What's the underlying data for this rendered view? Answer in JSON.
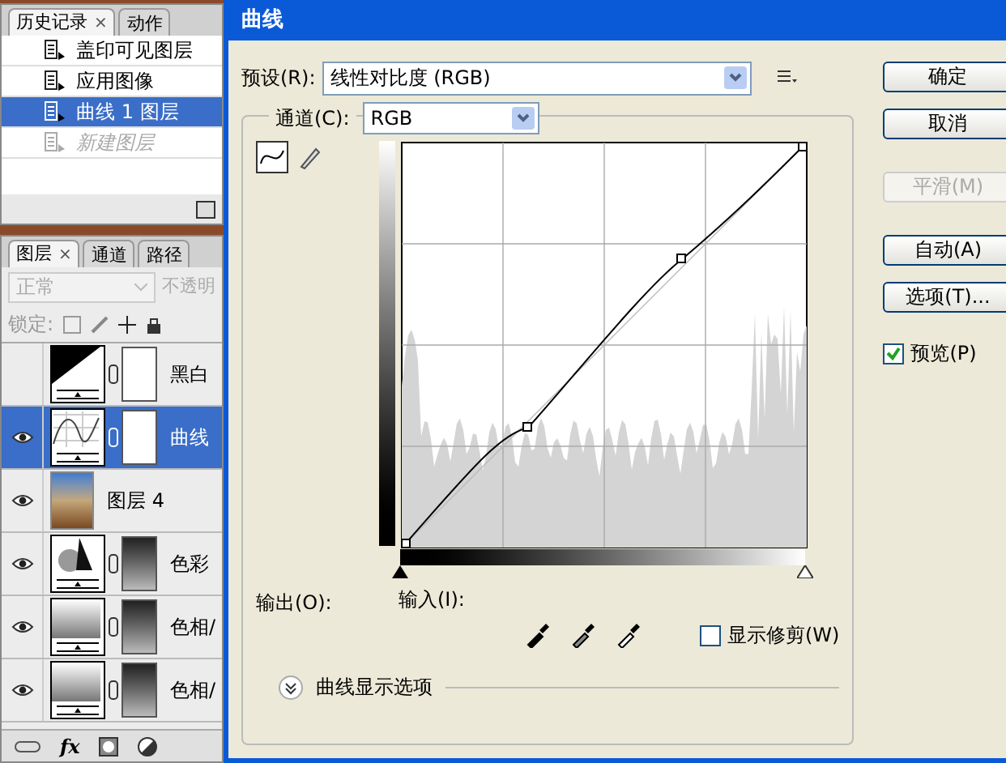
{
  "history": {
    "tabs": [
      {
        "label": "历史记录",
        "close": "×",
        "selected": true
      },
      {
        "label": "动作",
        "selected": false
      }
    ],
    "items": [
      {
        "label": "盖印可见图层",
        "selected": false,
        "disabled": false
      },
      {
        "label": "应用图像",
        "selected": false,
        "disabled": false
      },
      {
        "label": "曲线 1 图层",
        "selected": true,
        "disabled": false
      },
      {
        "label": "新建图层",
        "selected": false,
        "disabled": true
      }
    ]
  },
  "layers": {
    "tabs": [
      {
        "label": "图层",
        "close": "×",
        "selected": true
      },
      {
        "label": "通道",
        "selected": false
      },
      {
        "label": "路径",
        "selected": false
      }
    ],
    "blend_mode": "正常",
    "fx_label": "fx",
    "opacity_label": "不透明",
    "lock_label": "锁定:",
    "items": [
      {
        "name": "黑白",
        "kind": "bw",
        "visible": false,
        "selected": false
      },
      {
        "name": "曲线",
        "kind": "curves",
        "visible": true,
        "selected": true
      },
      {
        "name": "图层 4",
        "kind": "photo",
        "visible": true,
        "selected": false
      },
      {
        "name": "色彩",
        "kind": "balance",
        "visible": true,
        "selected": false
      },
      {
        "name": "色相/",
        "kind": "huesat",
        "visible": true,
        "selected": false
      },
      {
        "name": "色相/",
        "kind": "huesat",
        "visible": true,
        "selected": false
      }
    ]
  },
  "dialog": {
    "title": "曲线",
    "preset_label": "预设(R):",
    "preset_value": "线性对比度 (RGB)",
    "channel_label": "通道(C):",
    "channel_value": "RGB",
    "output_label": "输出(O):",
    "input_label": "输入(I):",
    "show_clipping": {
      "label": "显示修剪(W)",
      "checked": false
    },
    "display_options": "曲线显示选项",
    "buttons": [
      {
        "label": "确定",
        "disabled": false
      },
      {
        "label": "取消",
        "disabled": false
      },
      {
        "label": "平滑(M)",
        "disabled": true
      },
      {
        "label": "自动(A)",
        "disabled": false
      },
      {
        "label": "选项(T)...",
        "disabled": false
      }
    ],
    "preview": {
      "label": "预览(P)",
      "checked": true
    }
  }
}
